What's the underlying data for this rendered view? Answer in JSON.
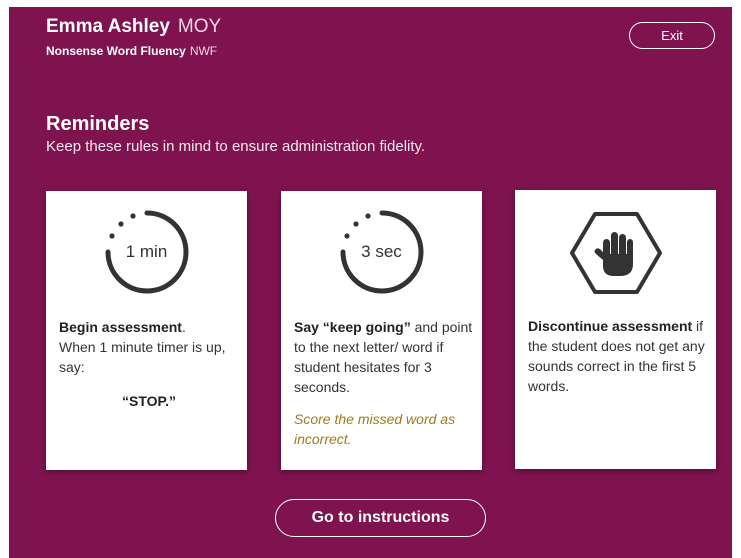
{
  "header": {
    "student_name": "Emma Ashley",
    "period": "MOY",
    "assessment_name": "Nonsense Word Fluency",
    "assessment_abbr": "NWF",
    "exit_label": "Exit"
  },
  "reminders": {
    "title": "Reminders",
    "subtitle": "Keep these rules in mind to ensure administration fidelity."
  },
  "cards": [
    {
      "icon": "timer-icon",
      "timer_label": "1 min",
      "bold_text": "Begin assessment",
      "text_after_bold": ".",
      "body": "When 1 minute timer is up, say:",
      "quote": "“STOP.”"
    },
    {
      "icon": "timer-icon",
      "timer_label": "3 sec",
      "bold_text": "Say “keep going”",
      "text_after_bold": " and point to the next letter/ word if student hesitates for 3 seconds.",
      "note": "Score the missed word as incorrect."
    },
    {
      "icon": "stop-hand-icon",
      "bold_text": "Discontinue assessment",
      "text_after_bold": " if the student does not get any sounds correct in the first 5 words."
    }
  ],
  "footer": {
    "go_label": "Go to instructions"
  },
  "colors": {
    "background": "#7e1350",
    "note_text": "#a07a1c"
  }
}
